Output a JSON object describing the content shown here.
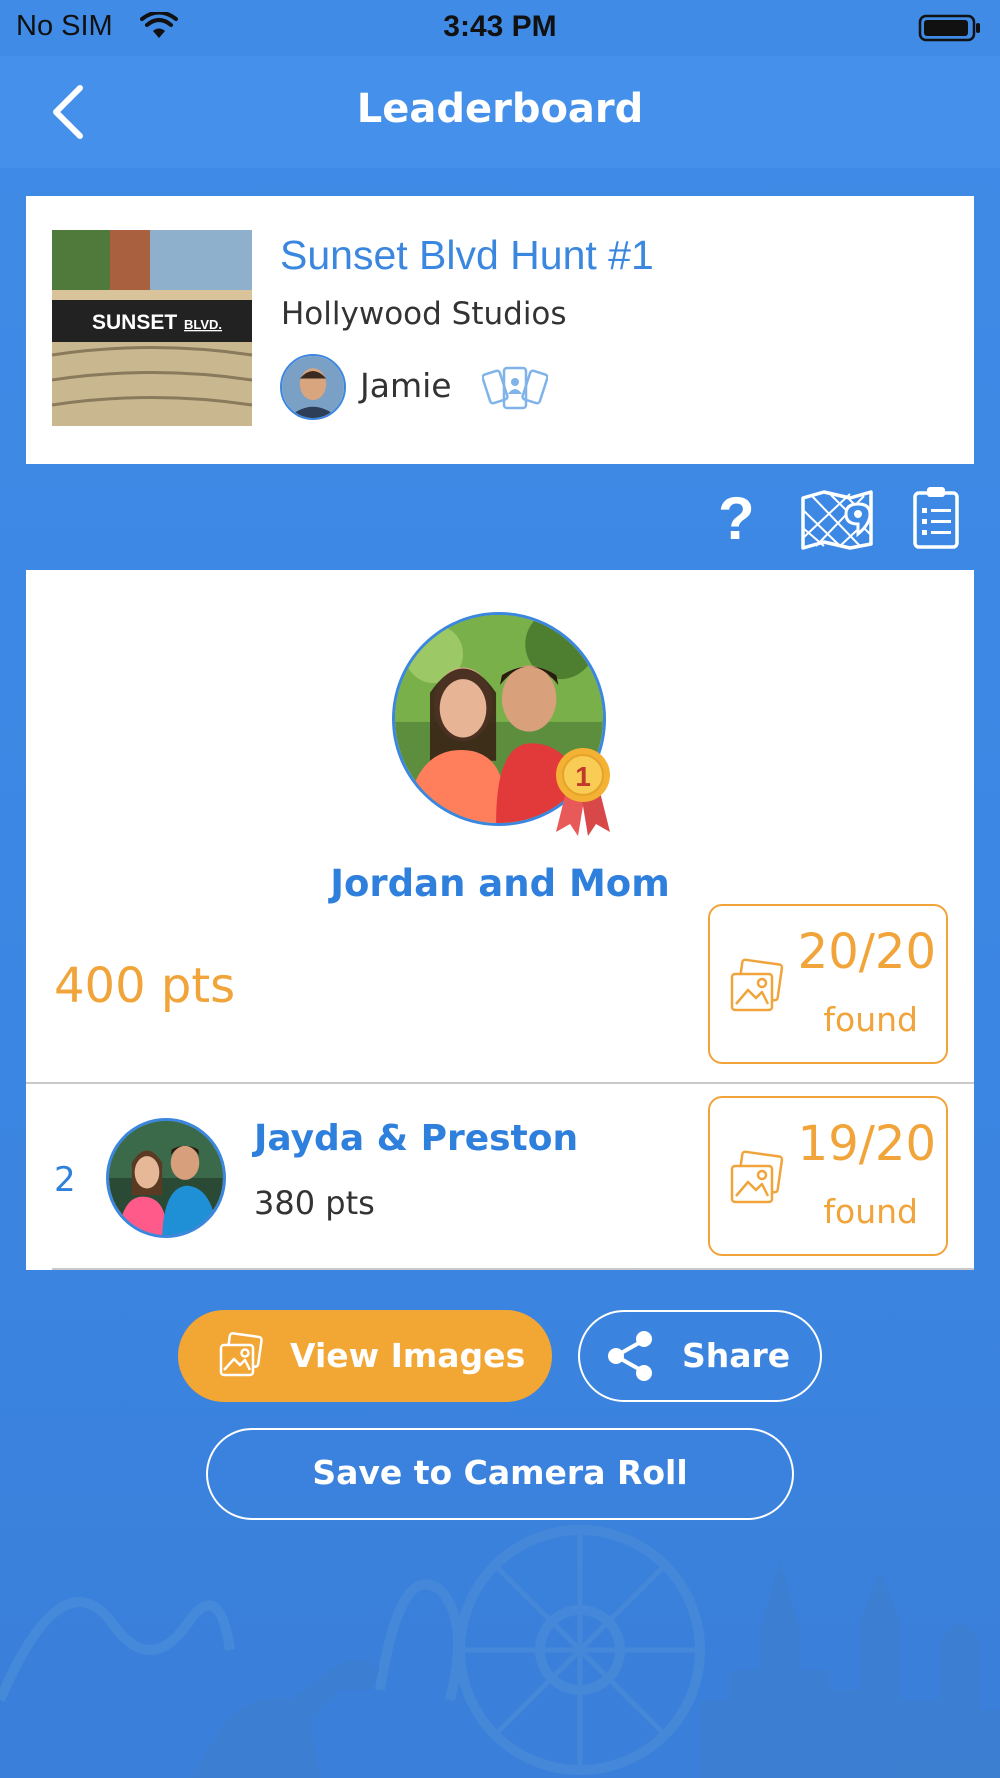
{
  "status_bar": {
    "carrier": "No SIM",
    "time": "3:43 PM"
  },
  "nav": {
    "title": "Leaderboard"
  },
  "hunt": {
    "title": "Sunset Blvd Hunt #1",
    "location": "Hollywood Studios",
    "creator": "Jamie",
    "thumb_sign_main": "SUNSET",
    "thumb_sign_sub": "BLVD."
  },
  "leaderboard": {
    "winner": {
      "rank_badge": "1",
      "name": "Jordan and Mom",
      "points": "400 pts",
      "found_count": "20/20",
      "found_label": "found"
    },
    "rows": [
      {
        "rank": "2",
        "name": "Jayda & Preston",
        "points": "380 pts",
        "found_count": "19/20",
        "found_label": "found"
      }
    ]
  },
  "actions": {
    "view_images": "View Images",
    "share": "Share",
    "save": "Save to Camera Roll"
  },
  "icons": {
    "back": "chevron-left-icon",
    "help": "question-icon",
    "map": "map-icon",
    "list": "clipboard-list-icon",
    "group": "group-devices-icon",
    "photo": "photo-icon",
    "share": "share-icon",
    "medal": "medal-icon"
  },
  "colors": {
    "background": "#3f8be6",
    "accent_blue": "#2f7fdc",
    "accent_orange": "#f0a43a",
    "card": "#ffffff"
  }
}
